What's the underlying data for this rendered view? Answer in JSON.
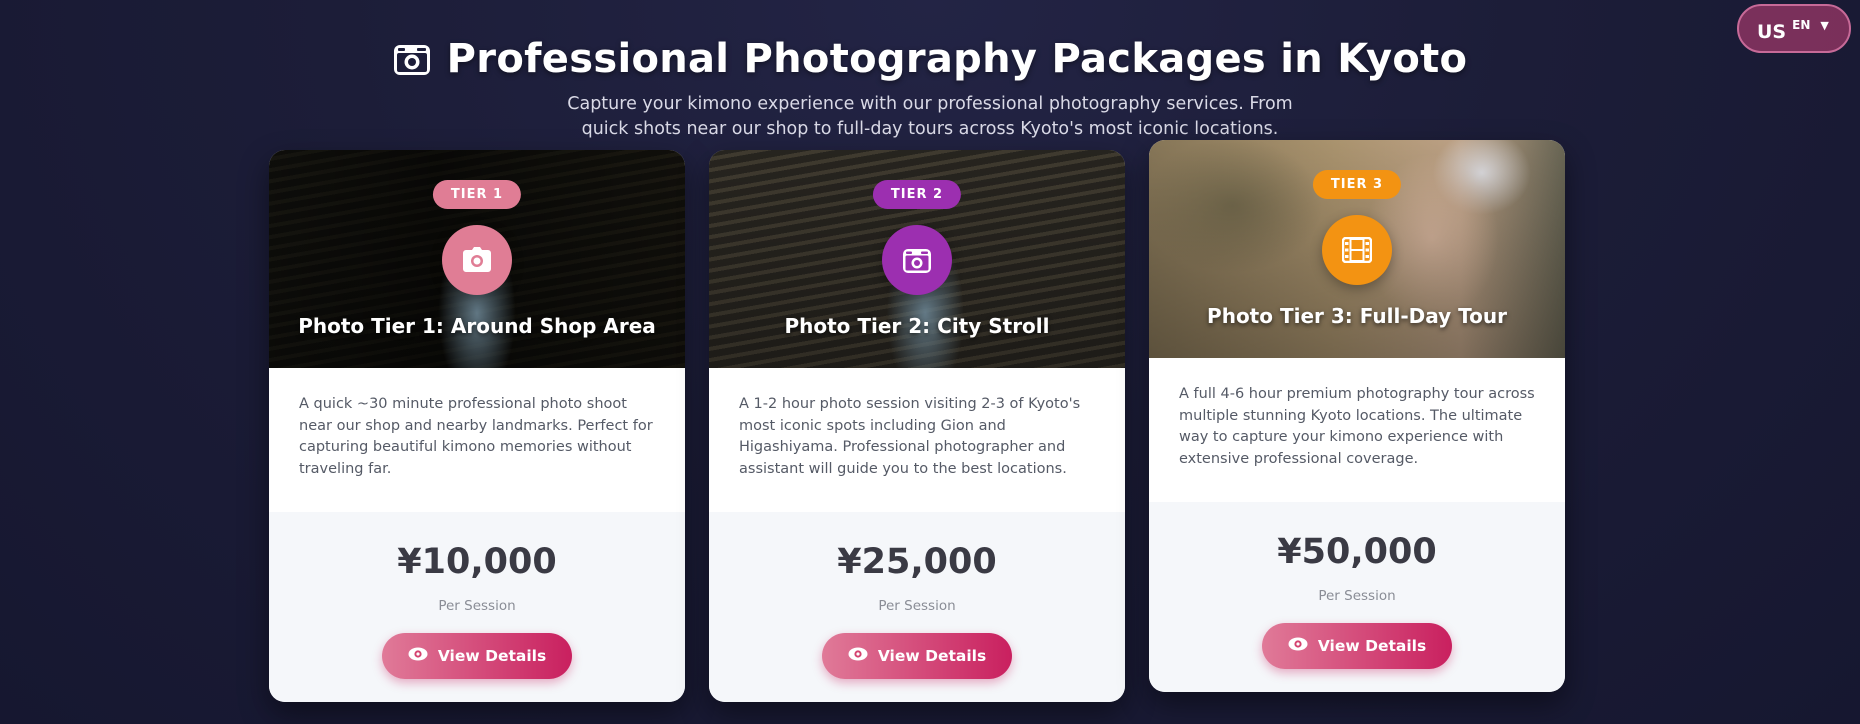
{
  "lang": {
    "flag": "US",
    "code": "EN",
    "caret": "▼"
  },
  "header": {
    "title": "Professional Photography Packages in Kyoto",
    "subtitle": "Capture your kimono experience with our professional photography services. From quick shots near our shop to full-day tours across Kyoto's most iconic locations."
  },
  "cards": [
    {
      "badge": "TIER 1",
      "title": "Photo Tier 1: Around Shop Area",
      "description": "A quick ~30 minute professional photo shoot near our shop and nearby landmarks. Perfect for capturing beautiful kimono memories without traveling far.",
      "price": "¥10,000",
      "per": "Per Session",
      "button": "View Details",
      "icon": "camera-icon",
      "accent": "#e07d95"
    },
    {
      "badge": "TIER 2",
      "title": "Photo Tier 2: City Stroll",
      "description": "A 1-2 hour photo session visiting 2-3 of Kyoto's most iconic spots including Gion and Higashiyama. Professional photographer and assistant will guide you to the best locations.",
      "price": "¥25,000",
      "per": "Per Session",
      "button": "View Details",
      "icon": "camera-retro-icon",
      "accent": "#9c2fb0"
    },
    {
      "badge": "TIER 3",
      "title": "Photo Tier 3: Full-Day Tour",
      "description": "A full 4-6 hour premium photography tour across multiple stunning Kyoto locations. The ultimate way to capture your kimono experience with extensive professional coverage.",
      "price": "¥50,000",
      "per": "Per Session",
      "button": "View Details",
      "icon": "film-icon",
      "accent": "#f39312"
    }
  ]
}
